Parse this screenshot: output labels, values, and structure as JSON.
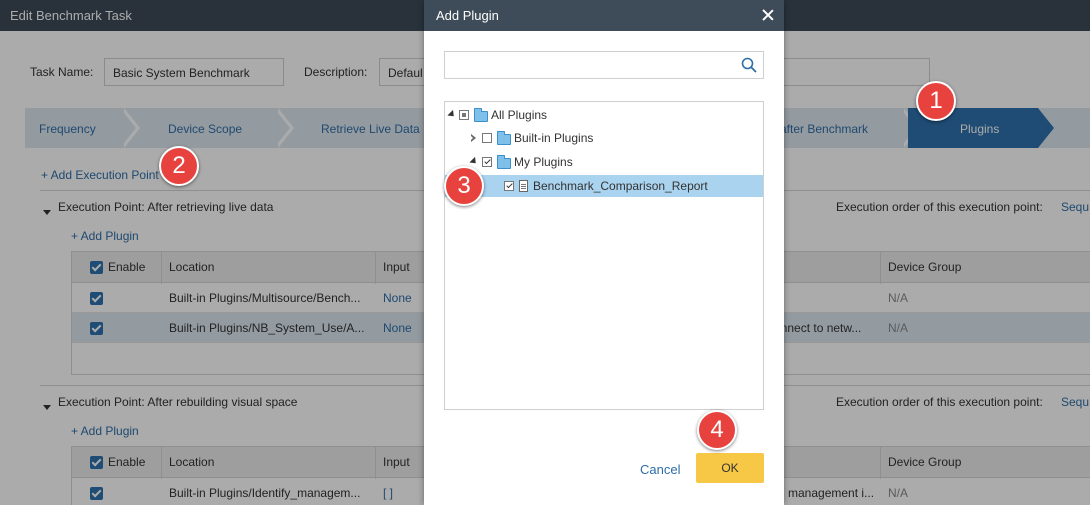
{
  "window": {
    "title": "Edit Benchmark Task"
  },
  "form": {
    "task_name_label": "Task Name:",
    "task_name_value": "Basic System Benchmark",
    "description_label": "Description:",
    "description_value": "Defaul"
  },
  "steps": {
    "frequency": "Frequency",
    "device_scope": "Device Scope",
    "retrieve_live_data": "Retrieve Live Data",
    "after_benchmark": "after Benchmark",
    "plugins": "Plugins"
  },
  "panel": {
    "add_execution_point": "+ Add Execution Point",
    "section1": {
      "title": "Execution Point: After retrieving live data",
      "order_label": "Execution order of this execution point:",
      "order_value": "Sequ",
      "add_plugin": "+ Add Plugin",
      "headers": {
        "enable": "Enable",
        "location": "Location",
        "input": "Input",
        "device_group": "Device Group"
      },
      "rows": [
        {
          "location": "Built-in Plugins/Multisource/Bench...",
          "input": "None",
          "desc": "",
          "device_group": "N/A"
        },
        {
          "location": "Built-in Plugins/NB_System_Use/A...",
          "input": "None",
          "desc": "onnect to netw...",
          "device_group": "N/A"
        }
      ]
    },
    "section2": {
      "title": "Execution Point: After rebuilding visual space",
      "order_label": "Execution order of this execution point:",
      "order_value": "Sequ",
      "add_plugin": "+ Add Plugin",
      "headers": {
        "enable": "Enable",
        "location": "Location",
        "input": "Input",
        "device_group": "Device Group"
      },
      "rows": [
        {
          "location": "Built-in Plugins/Identify_managem...",
          "input": "[ ]",
          "desc": "management i...",
          "device_group": "N/A"
        }
      ]
    }
  },
  "dialog": {
    "title": "Add Plugin",
    "search_placeholder": "",
    "tree": {
      "all": "All Plugins",
      "builtin": "Built-in Plugins",
      "my": "My Plugins",
      "item": "Benchmark_Comparison_Report"
    },
    "cancel": "Cancel",
    "ok": "OK"
  },
  "markers": [
    "1",
    "2",
    "3",
    "4"
  ],
  "colors": {
    "accent": "#2f72ad",
    "ok_button": "#f7c846",
    "marker": "#e8423f",
    "titlebar": "#3e4b58"
  }
}
